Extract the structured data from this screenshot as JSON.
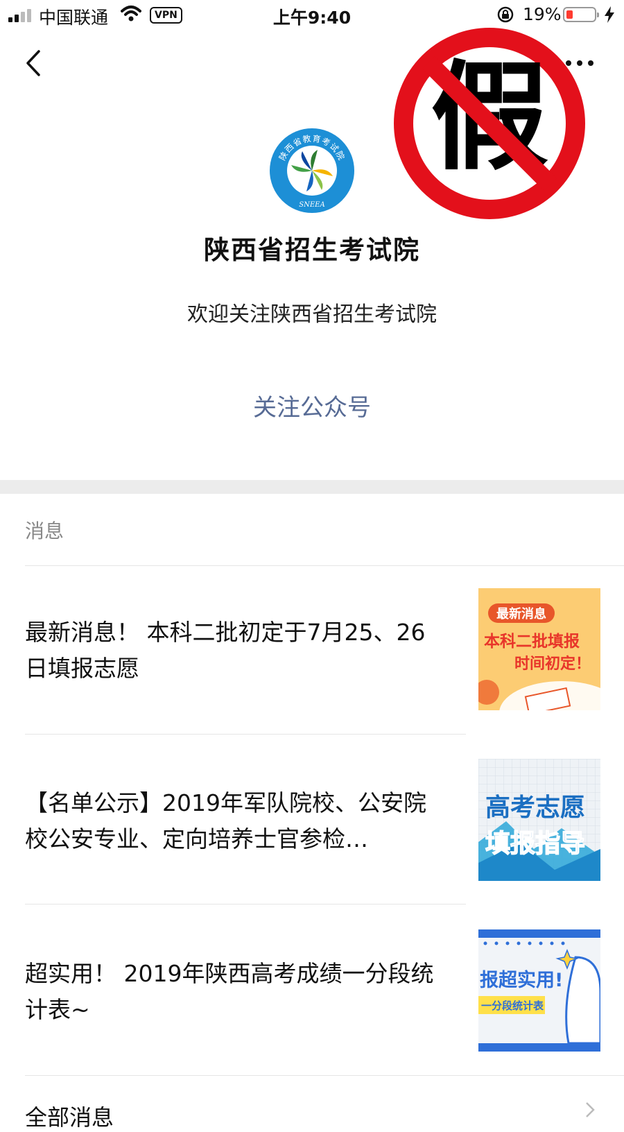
{
  "status_bar": {
    "carrier": "中国联通",
    "vpn": "VPN",
    "time": "上午9:40",
    "battery_percent": "19%",
    "battery_level": 0.19,
    "icons": [
      "signal-icon",
      "wifi-icon",
      "rotation-lock-icon",
      "battery-icon",
      "charging-icon"
    ]
  },
  "nav": {
    "back_icon": "chevron-left-icon",
    "more_icon": "more-dots-icon"
  },
  "stamp": {
    "character": "假"
  },
  "profile": {
    "logo_text_top": "陕西省教育考试院",
    "logo_text_bottom": "SNEEA",
    "name": "陕西省招生考试院",
    "welcome": "欢迎关注陕西省招生考试院",
    "follow_label": "关注公众号"
  },
  "messages": {
    "header": "消息",
    "items": [
      {
        "title": "最新消息！ 本科二批初定于7月25、26日填报志愿",
        "thumb": {
          "tag": "最新消息",
          "line1": "本科二批填报",
          "line2": "时间初定！"
        }
      },
      {
        "title": "【名单公示】2019年军队院校、公安院校公安专业、定向培养士官参检…",
        "thumb": {
          "line1": "高考志愿",
          "line2": "填报指导"
        }
      },
      {
        "title": "超实用！ 2019年陕西高考成绩一分段统计表~",
        "thumb": {
          "line1": "报超实用!",
          "line2": "一分段统计表"
        }
      }
    ],
    "all_label": "全部消息"
  },
  "colors": {
    "link": "#576b95",
    "stamp_red": "#e3101b",
    "divider": "#e5e5e5"
  }
}
